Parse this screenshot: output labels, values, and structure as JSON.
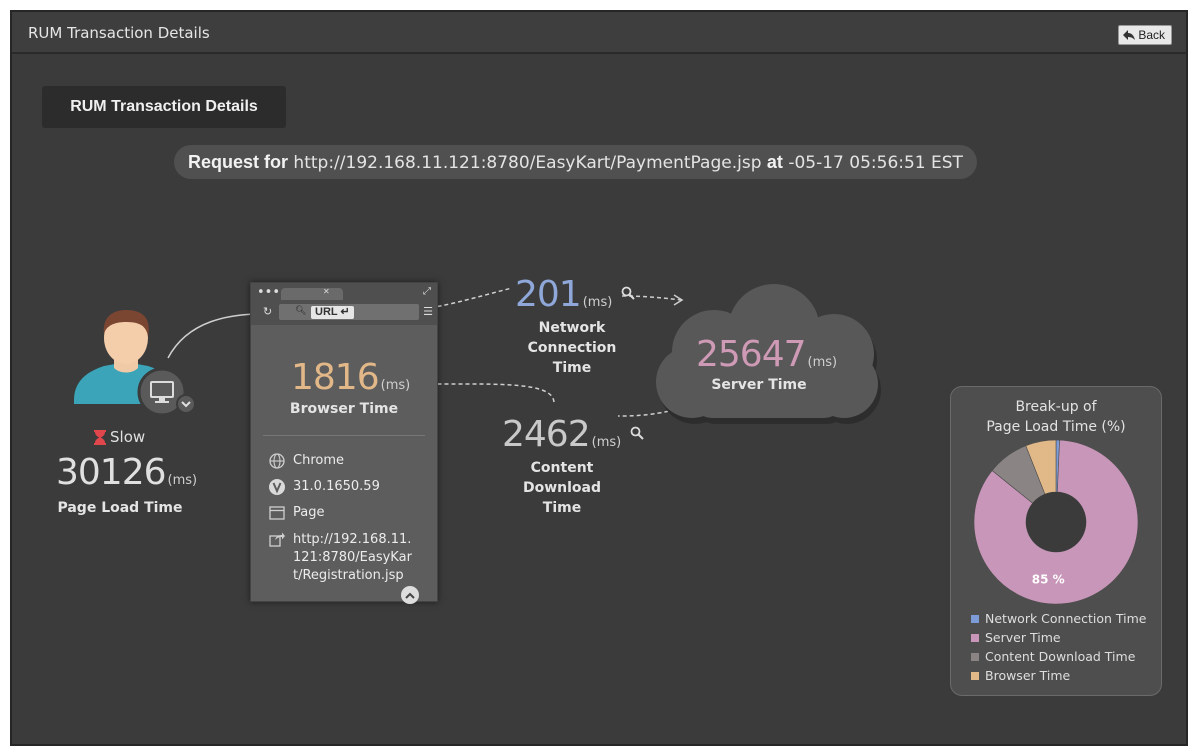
{
  "window": {
    "title": "RUM Transaction Details",
    "back_label": "Back"
  },
  "header": {
    "title": "RUM Transaction Details"
  },
  "request": {
    "prefix": "Request for",
    "url": "http://192.168.11.121:8780/EasyKart/PaymentPage.jsp",
    "at_label": "at",
    "timestamp": "-05-17 05:56:51 EST"
  },
  "user": {
    "status": "Slow",
    "page_load_value": "30126",
    "unit": "(ms)",
    "page_load_label": "Page Load Time"
  },
  "browser": {
    "url_label": "URL",
    "time_value": "1816",
    "unit": "(ms)",
    "time_label": "Browser Time",
    "name": "Chrome",
    "version": "31.0.1650.59",
    "type": "Page",
    "page_url": "http://192.168.11.121:8780/EasyKart/Registration.jsp"
  },
  "network": {
    "value": "201",
    "unit": "(ms)",
    "label_line1": "Network Connection",
    "label_line2": "Time"
  },
  "server": {
    "value": "25647",
    "unit": "(ms)",
    "label": "Server Time"
  },
  "content": {
    "value": "2462",
    "unit": "(ms)",
    "label_line1": "Content Download",
    "label_line2": "Time"
  },
  "chart_data": {
    "type": "pie",
    "title": "Break-up of Page Load Time (%)",
    "title_line1": "Break-up of",
    "title_line2": "Page Load Time (%)",
    "categories": [
      "Network Connection Time",
      "Server Time",
      "Content Download Time",
      "Browser Time"
    ],
    "values": [
      0.7,
      85.1,
      8.2,
      6.0
    ],
    "colors": [
      "#7d9bd6",
      "#c896b8",
      "#8a8484",
      "#e1b887"
    ],
    "data_labels": [
      {
        "category": "Server Time",
        "text": "85 %"
      }
    ],
    "donut": true,
    "legend_position": "bottom"
  }
}
